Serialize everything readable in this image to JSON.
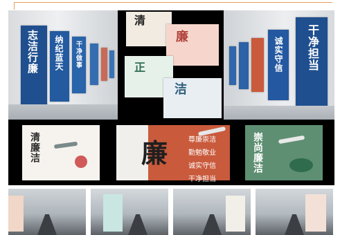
{
  "collage": {
    "corridor_top_left": {
      "poster_a_text": "志洁行廉",
      "poster_b_text": "纳纪蓝天",
      "poster_c_text": "干净做事"
    },
    "poster_grid": {
      "p1": "清",
      "p2": "廉",
      "p3": "正",
      "p4": "洁"
    },
    "corridor_top_right": {
      "poster_a_text": "干净担当",
      "poster_b_text": "诚实守信"
    },
    "middle_row": {
      "left_title": "清廉洁",
      "center_title": "廉",
      "center_lines": [
        "尊廉崇洁",
        "勤勉敬业",
        "诚实守信",
        "干净担当"
      ],
      "right_title": "崇尚廉洁"
    }
  },
  "colors": {
    "frame_accent": "#e7a15b",
    "blue_poster": "#1f4f8f",
    "red_poster": "#c95a3c",
    "green_poster": "#5e8f72"
  }
}
